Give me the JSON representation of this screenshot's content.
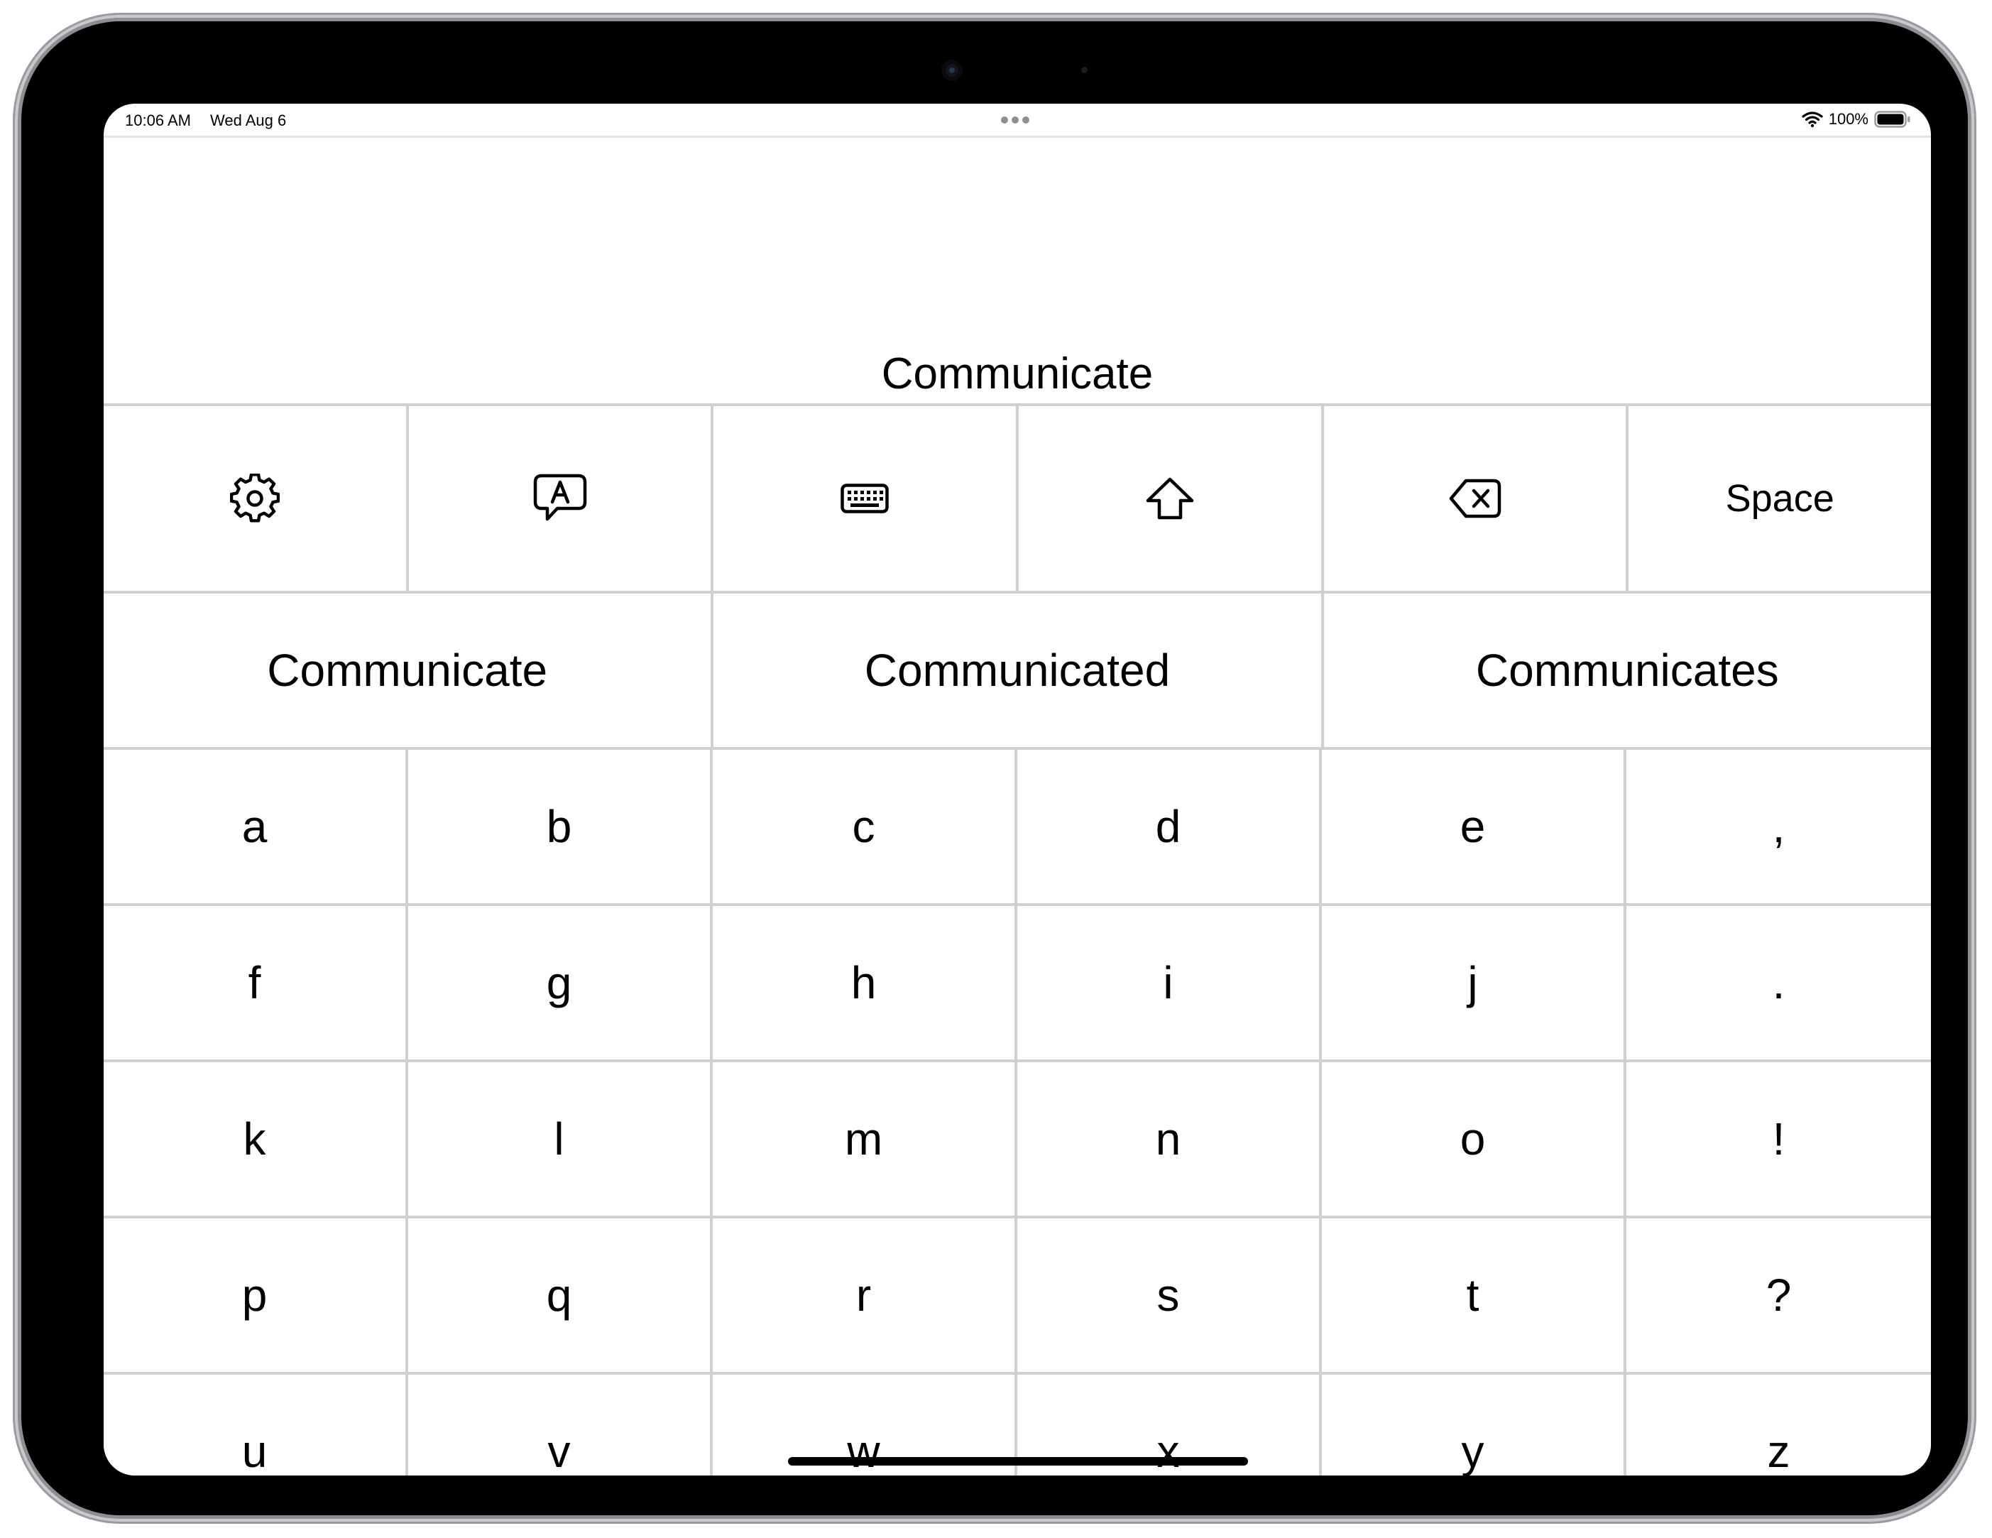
{
  "status_bar": {
    "time": "10:06 AM",
    "date": "Wed Aug 6",
    "battery_percent_label": "100%",
    "battery_level": 1.0
  },
  "composed_text": "Communicate",
  "toolbar": [
    {
      "name": "settings-button",
      "icon": "gear-icon"
    },
    {
      "name": "speak-button",
      "icon": "speech-bubble-a-icon"
    },
    {
      "name": "keyboard-button",
      "icon": "keyboard-icon"
    },
    {
      "name": "shift-button",
      "icon": "shift-arrow-icon"
    },
    {
      "name": "delete-button",
      "icon": "delete-backward-icon"
    },
    {
      "name": "space-button",
      "label": "Space"
    }
  ],
  "suggestions": [
    "Communicate",
    "Communicated",
    "Communicates"
  ],
  "keys": [
    "a",
    "b",
    "c",
    "d",
    "e",
    ",",
    "f",
    "g",
    "h",
    "i",
    "j",
    ".",
    "k",
    "l",
    "m",
    "n",
    "o",
    "!",
    "p",
    "q",
    "r",
    "s",
    "t",
    "?",
    "u",
    "v",
    "w",
    "x",
    "y",
    "z"
  ],
  "colors": {
    "frame": "#000000",
    "screen_background": "#ffffff",
    "grid_line": "#cfcfcf",
    "text": "#000000"
  }
}
